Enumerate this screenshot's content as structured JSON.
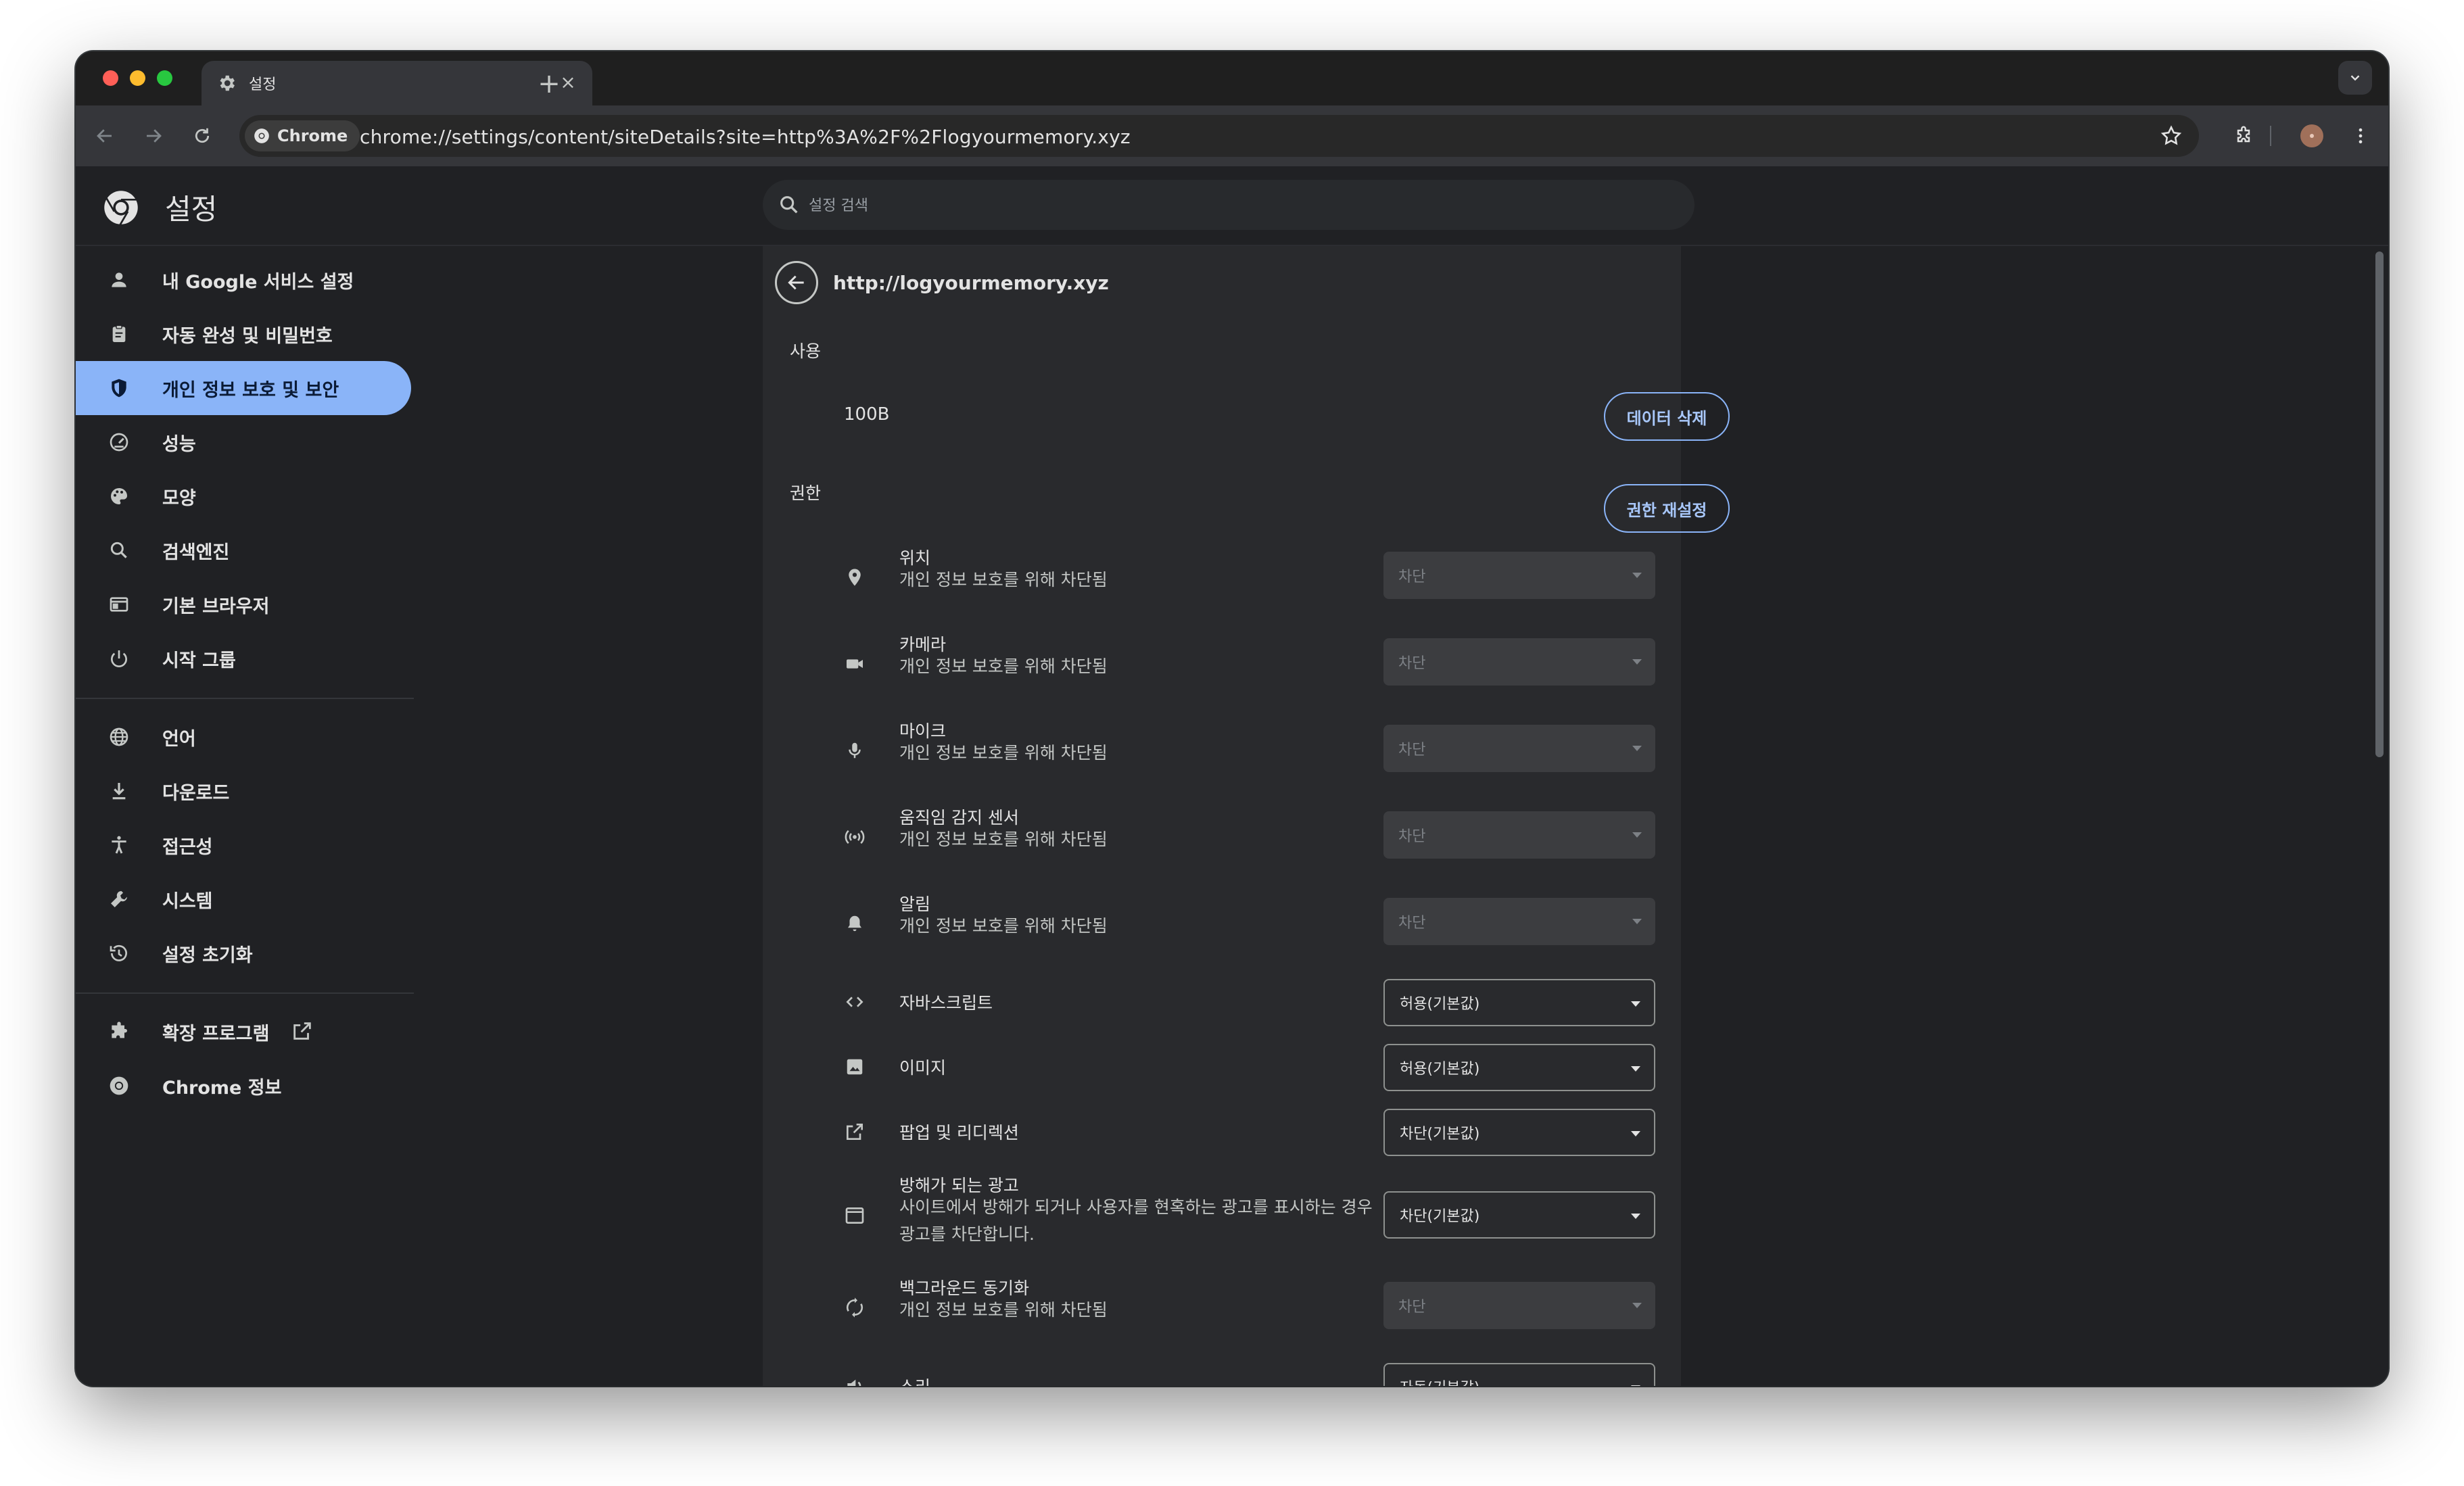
{
  "browser": {
    "tab_title": "설정",
    "chip_label": "Chrome",
    "url": "chrome://settings/content/siteDetails?site=http%3A%2F%2Flogyourmemory.xyz",
    "traffic_light_colors": [
      "#ff5f57",
      "#febc2e",
      "#28c840"
    ]
  },
  "header": {
    "title": "설정",
    "search_placeholder": "설정 검색"
  },
  "sidebar": {
    "items": [
      {
        "label": "내 Google 서비스 설정",
        "icon": "person-icon"
      },
      {
        "label": "자동 완성 및 비밀번호",
        "icon": "clipboard-icon"
      },
      {
        "label": "개인 정보 보호 및 보안",
        "icon": "shield-icon",
        "active": true
      },
      {
        "label": "성능",
        "icon": "speedometer-icon"
      },
      {
        "label": "모양",
        "icon": "palette-icon"
      },
      {
        "label": "검색엔진",
        "icon": "search-icon"
      },
      {
        "label": "기본 브라우저",
        "icon": "browser-icon"
      },
      {
        "label": "시작 그룹",
        "icon": "power-icon"
      },
      {
        "label": "언어",
        "icon": "globe-icon"
      },
      {
        "label": "다운로드",
        "icon": "download-icon"
      },
      {
        "label": "접근성",
        "icon": "accessibility-icon"
      },
      {
        "label": "시스템",
        "icon": "wrench-icon"
      },
      {
        "label": "설정 초기화",
        "icon": "history-icon"
      },
      {
        "label": "확장 프로그램",
        "icon": "puzzle-icon"
      },
      {
        "label": "Chrome 정보",
        "icon": "chrome-icon"
      }
    ]
  },
  "site": {
    "origin": "http://logyourmemory.xyz",
    "usage_label": "사용",
    "usage_value": "100B",
    "clear_data_label": "데이터 삭제",
    "permissions_label": "권한",
    "reset_permissions_label": "권한 재설정"
  },
  "permissions": [
    {
      "title": "위치",
      "subtitle": "개인 정보 보호를 위해 차단됨",
      "value": "차단",
      "disabled": true,
      "icon": "location-pin-icon"
    },
    {
      "title": "카메라",
      "subtitle": "개인 정보 보호를 위해 차단됨",
      "value": "차단",
      "disabled": true,
      "icon": "camera-icon"
    },
    {
      "title": "마이크",
      "subtitle": "개인 정보 보호를 위해 차단됨",
      "value": "차단",
      "disabled": true,
      "icon": "microphone-icon"
    },
    {
      "title": "움직임 감지 센서",
      "subtitle": "개인 정보 보호를 위해 차단됨",
      "value": "차단",
      "disabled": true,
      "icon": "sensors-icon"
    },
    {
      "title": "알림",
      "subtitle": "개인 정보 보호를 위해 차단됨",
      "value": "차단",
      "disabled": true,
      "icon": "bell-icon"
    },
    {
      "title": "자바스크립트",
      "subtitle": "",
      "value": "허용(기본값)",
      "disabled": false,
      "icon": "code-icon"
    },
    {
      "title": "이미지",
      "subtitle": "",
      "value": "허용(기본값)",
      "disabled": false,
      "icon": "image-icon"
    },
    {
      "title": "팝업 및 리디렉션",
      "subtitle": "",
      "value": "차단(기본값)",
      "disabled": false,
      "icon": "open-in-new-icon"
    },
    {
      "title": "방해가 되는 광고",
      "subtitle_lines": [
        "사이트에서 방해가 되거나 사용자를 현혹하는 광고를 표시하는 경우",
        "광고를 차단합니다."
      ],
      "value": "차단(기본값)",
      "disabled": false,
      "icon": "ads-icon"
    },
    {
      "title": "백그라운드 동기화",
      "subtitle": "개인 정보 보호를 위해 차단됨",
      "value": "차단",
      "disabled": true,
      "icon": "sync-icon"
    },
    {
      "title": "소리",
      "subtitle": "",
      "value": "자동(기본값)",
      "disabled": false,
      "icon": "speaker-icon"
    }
  ]
}
